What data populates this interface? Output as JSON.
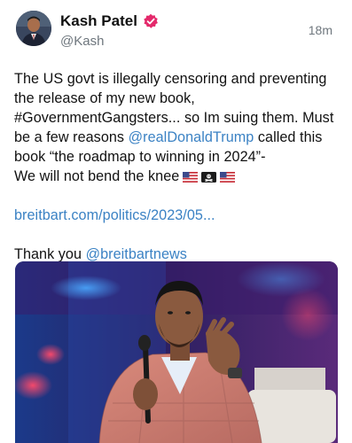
{
  "author": {
    "name": "Kash Patel",
    "handle": "@Kash",
    "verified": true,
    "avatar_icon": "profile-photo"
  },
  "timestamp": "18m",
  "post": {
    "line1": "The US govt is illegally censoring and preventing",
    "line2": "the release of my new book,",
    "line3": "#GovernmentGangsters... so Im suing them. Must",
    "line4_pre": "be a few reasons ",
    "line4_mention": "@realDonaldTrump",
    "line4_post": " called this",
    "line5": "book “the roadmap to winning in 2024”-",
    "line6": "We will not bend the knee",
    "flags": [
      "flag-usa-icon",
      "flag-pirate-icon",
      "flag-usa-icon"
    ],
    "link": "breitbart.com/politics/2023/05...",
    "thanks_pre": "Thank you ",
    "thanks_mention": "@breitbartnews"
  },
  "media": {
    "type": "photo",
    "icon": "speaker-with-microphone-photo"
  },
  "colors": {
    "link": "#3b82c4",
    "verified": "#e4296b",
    "handle": "#6e767d"
  }
}
